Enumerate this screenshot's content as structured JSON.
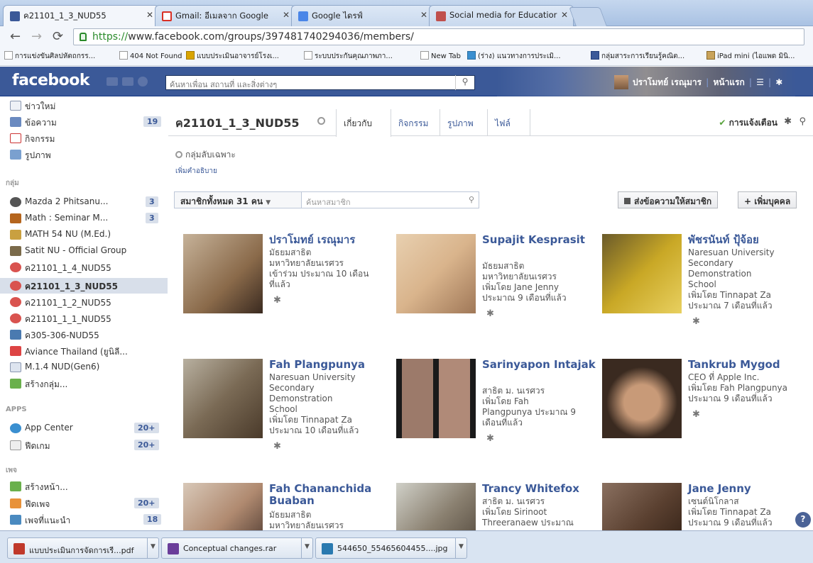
{
  "tabs": [
    {
      "title": "ค21101_1_3_NUD55",
      "color": "#3b5998",
      "active": true
    },
    {
      "title": "Gmail: อีเมลจาก Google",
      "color": "#d93025",
      "active": false
    },
    {
      "title": "Google ไดรฟ์",
      "color": "#4a86e8",
      "active": false
    },
    {
      "title": "Social media for Educatior",
      "color": "#c0504d",
      "active": false
    }
  ],
  "address": {
    "https": "https://",
    "rest": "www.facebook.com/groups/397481740294036/members/"
  },
  "bookmarks": [
    "การแข่งขันศิลปหัตถกรร...",
    "404 Not Found",
    "แบบประเมินอาจารย์โรงเ...",
    "ระบบประกันคุณภาพภา...",
    "New Tab",
    "(ร่าง) แนวทางการประเมิ...",
    "กลุ่มสาระการเรียนรู้คณิต...",
    "iPad mini (ไอแพด มินิ..."
  ],
  "facebook": {
    "logo": "facebook",
    "search_placeholder": "ค้นหาเพื่อน สถานที่ และสิ่งต่างๆ",
    "user_name": "ปราโมทย์ เรณุมาร",
    "home": "หน้าแรก"
  },
  "sidebar": {
    "top": [
      {
        "label": "ข่าวใหม่",
        "count": ""
      },
      {
        "label": "ข้อความ",
        "count": "19"
      },
      {
        "label": "กิจกรรม",
        "count": ""
      },
      {
        "label": "รูปภาพ",
        "count": ""
      }
    ],
    "groups_header": "กลุ่ม",
    "groups": [
      {
        "label": "Mazda 2 Phitsanu...",
        "count": "3"
      },
      {
        "label": "Math : Seminar M...",
        "count": "3"
      },
      {
        "label": "MATH 54 NU (M.Ed.)",
        "count": ""
      },
      {
        "label": "Satit NU - Official Group",
        "count": ""
      },
      {
        "label": "ค21101_1_4_NUD55",
        "count": ""
      },
      {
        "label": "ค21101_1_3_NUD55",
        "count": ""
      },
      {
        "label": "ค21101_1_2_NUD55",
        "count": ""
      },
      {
        "label": "ค21101_1_1_NUD55",
        "count": ""
      },
      {
        "label": "ค305-306-NUD55",
        "count": ""
      },
      {
        "label": "Aviance Thailand (ยูนิลี...",
        "count": ""
      },
      {
        "label": "M.1.4 NUD(Gen6)",
        "count": ""
      },
      {
        "label": "สร้างกลุ่ม...",
        "count": ""
      }
    ],
    "apps_header": "APPS",
    "apps": [
      {
        "label": "App Center",
        "count": "20+"
      },
      {
        "label": "ฟีดเกม",
        "count": "20+"
      }
    ],
    "pages_header": "เพจ",
    "pages": [
      {
        "label": "สร้างหน้า...",
        "count": ""
      },
      {
        "label": "ฟีดเพจ",
        "count": "20+"
      },
      {
        "label": "เพจที่แนะนำ",
        "count": "18"
      }
    ]
  },
  "group": {
    "name": "ค21101_1_3_NUD55",
    "tabs": [
      "เกี่ยวกับ",
      "กิจกรรม",
      "รูปภาพ",
      "ไฟล์"
    ],
    "notifications": "การแจ้งเตือน",
    "type": "กลุ่มลับเฉพาะ",
    "add_description": "เพิ่มคำอธิบาย",
    "members_select": "สมาชิกทั้งหมด 31 คน",
    "member_search_placeholder": "ค้นหาสมาชิก",
    "message_members": "ส่งข้อความให้สมาชิก",
    "add_people": "+ เพิ่มบุคคล"
  },
  "members": [
    {
      "name": "ปราโมทย์ เรณุมาร",
      "info": [
        "มัธยมสาธิต",
        "มหาวิทยาลัยนเรศวร",
        "เข้าร่วม ประมาณ 10 เดือน",
        "ที่แล้ว"
      ],
      "photo": "#8a6a4a"
    },
    {
      "name": "Supajit Kesprasit",
      "info": [
        "มัธยมสาธิต",
        "มหาวิทยาลัยนเรศวร",
        "เพิ่มโดย Jane Jenny",
        "ประมาณ 9 เดือนที่แล้ว"
      ],
      "photo": "#d9b48c"
    },
    {
      "name": "พัชรนันท์ ปุ้จ้อย",
      "info": [
        "Naresuan University",
        "Secondary",
        "Demonstration",
        "School",
        "เพิ่มโดย Tinnapat Za",
        "ประมาณ 7 เดือนที่แล้ว"
      ],
      "photo": "#c9a826"
    },
    {
      "name": "Fah Plangpunya",
      "info": [
        "Naresuan University",
        "Secondary",
        "Demonstration",
        "School",
        "เพิ่มโดย Tinnapat Za",
        "ประมาณ 10 เดือนที่แล้ว"
      ],
      "photo": "#7a6a55"
    },
    {
      "name": "Sarinyapon Intajak",
      "info": [
        "สาธิต ม. นเรศวร",
        "เพิ่มโดย Fah",
        "Plangpunya ประมาณ 9",
        "เดือนที่แล้ว"
      ],
      "photo": "#9c7a6a"
    },
    {
      "name": "Tankrub Mygod",
      "info": [
        "CEO ที่ Apple Inc.",
        "เพิ่มโดย Fah Plangpunya",
        "ประมาณ 9 เดือนที่แล้ว"
      ],
      "photo": "#6a5040"
    },
    {
      "name": "Fah Chananchida Buaban",
      "info": [
        "มัธยมสาธิต",
        "มหาวิทยาลัยนเรศวร"
      ],
      "photo": "#b08a70"
    },
    {
      "name": "Trancy Whitefox",
      "info": [
        "สาธิต ม. นเรศวร",
        "เพิ่มโดย Sirinoot",
        "Threeranaew ประมาณ"
      ],
      "photo": "#8a8070"
    },
    {
      "name": "Jane Jenny",
      "info": [
        "เซนต์นิโกลาส",
        "เพิ่มโดย Tinnapat Za",
        "ประมาณ 9 เดือนที่แล้ว"
      ],
      "photo": "#5a4030"
    }
  ],
  "downloads": [
    {
      "name": "แบบประเมินการจัดการเรี...pdf",
      "color": "#c0392b"
    },
    {
      "name": "Conceptual changes.rar",
      "color": "#6a3d9a"
    },
    {
      "name": "544650_55465604455....jpg",
      "color": "#2a7ab0"
    }
  ]
}
